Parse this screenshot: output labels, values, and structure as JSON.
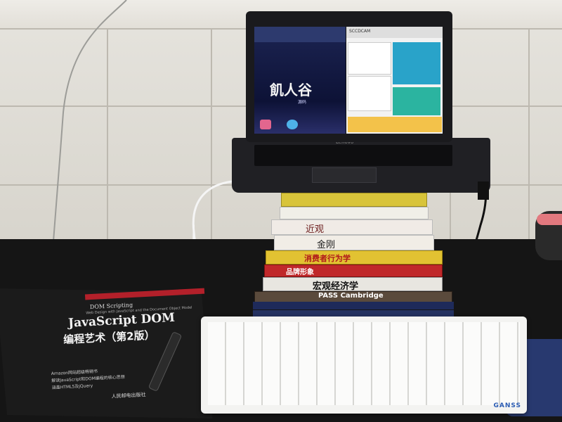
{
  "laptop": {
    "brand": "Lenovo",
    "screen_left": {
      "logo_text": "飢人谷",
      "logo_subtitle": "源码"
    },
    "screen_right": {
      "tab_title": "SCCDCAM"
    }
  },
  "book_stack": {
    "spines": [
      {
        "text": "",
        "color": "#d8c43a"
      },
      {
        "text": "",
        "color": "#f0efe8"
      },
      {
        "text": "近观",
        "color": "#f0ebe6"
      },
      {
        "text": "金刚",
        "color": "#f1ede6"
      },
      {
        "text": "消费者行为学",
        "color": "#e2c232"
      },
      {
        "text": "品牌形象",
        "color": "#c0282a"
      },
      {
        "text": "宏观经济学",
        "color": "#e8e6e0"
      },
      {
        "text": "PASS Cambridge",
        "color": "#5a4a3c"
      },
      {
        "text": "",
        "color": "#1e2a5a"
      },
      {
        "text": "",
        "color": "#243160"
      }
    ]
  },
  "desk_book": {
    "series": "DOM Scripting",
    "subtitle_en": "Web Design with JavaScript and the Document Object Model",
    "title": "JavaScript DOM",
    "title_cn": "编程艺术（第2版）",
    "bullets": [
      "Amazon网站超级畅销书",
      "解读JavaScript和DOM编程的核心思想",
      "涵盖HTML5及jQuery"
    ],
    "publisher": "人民邮电出版社"
  },
  "keyboard": {
    "brand": "GANSS"
  },
  "colors": {
    "desk": "#151515",
    "wall": "#e0ddd6",
    "book_red": "#b3202a",
    "keyboard": "#f3f3f1"
  }
}
